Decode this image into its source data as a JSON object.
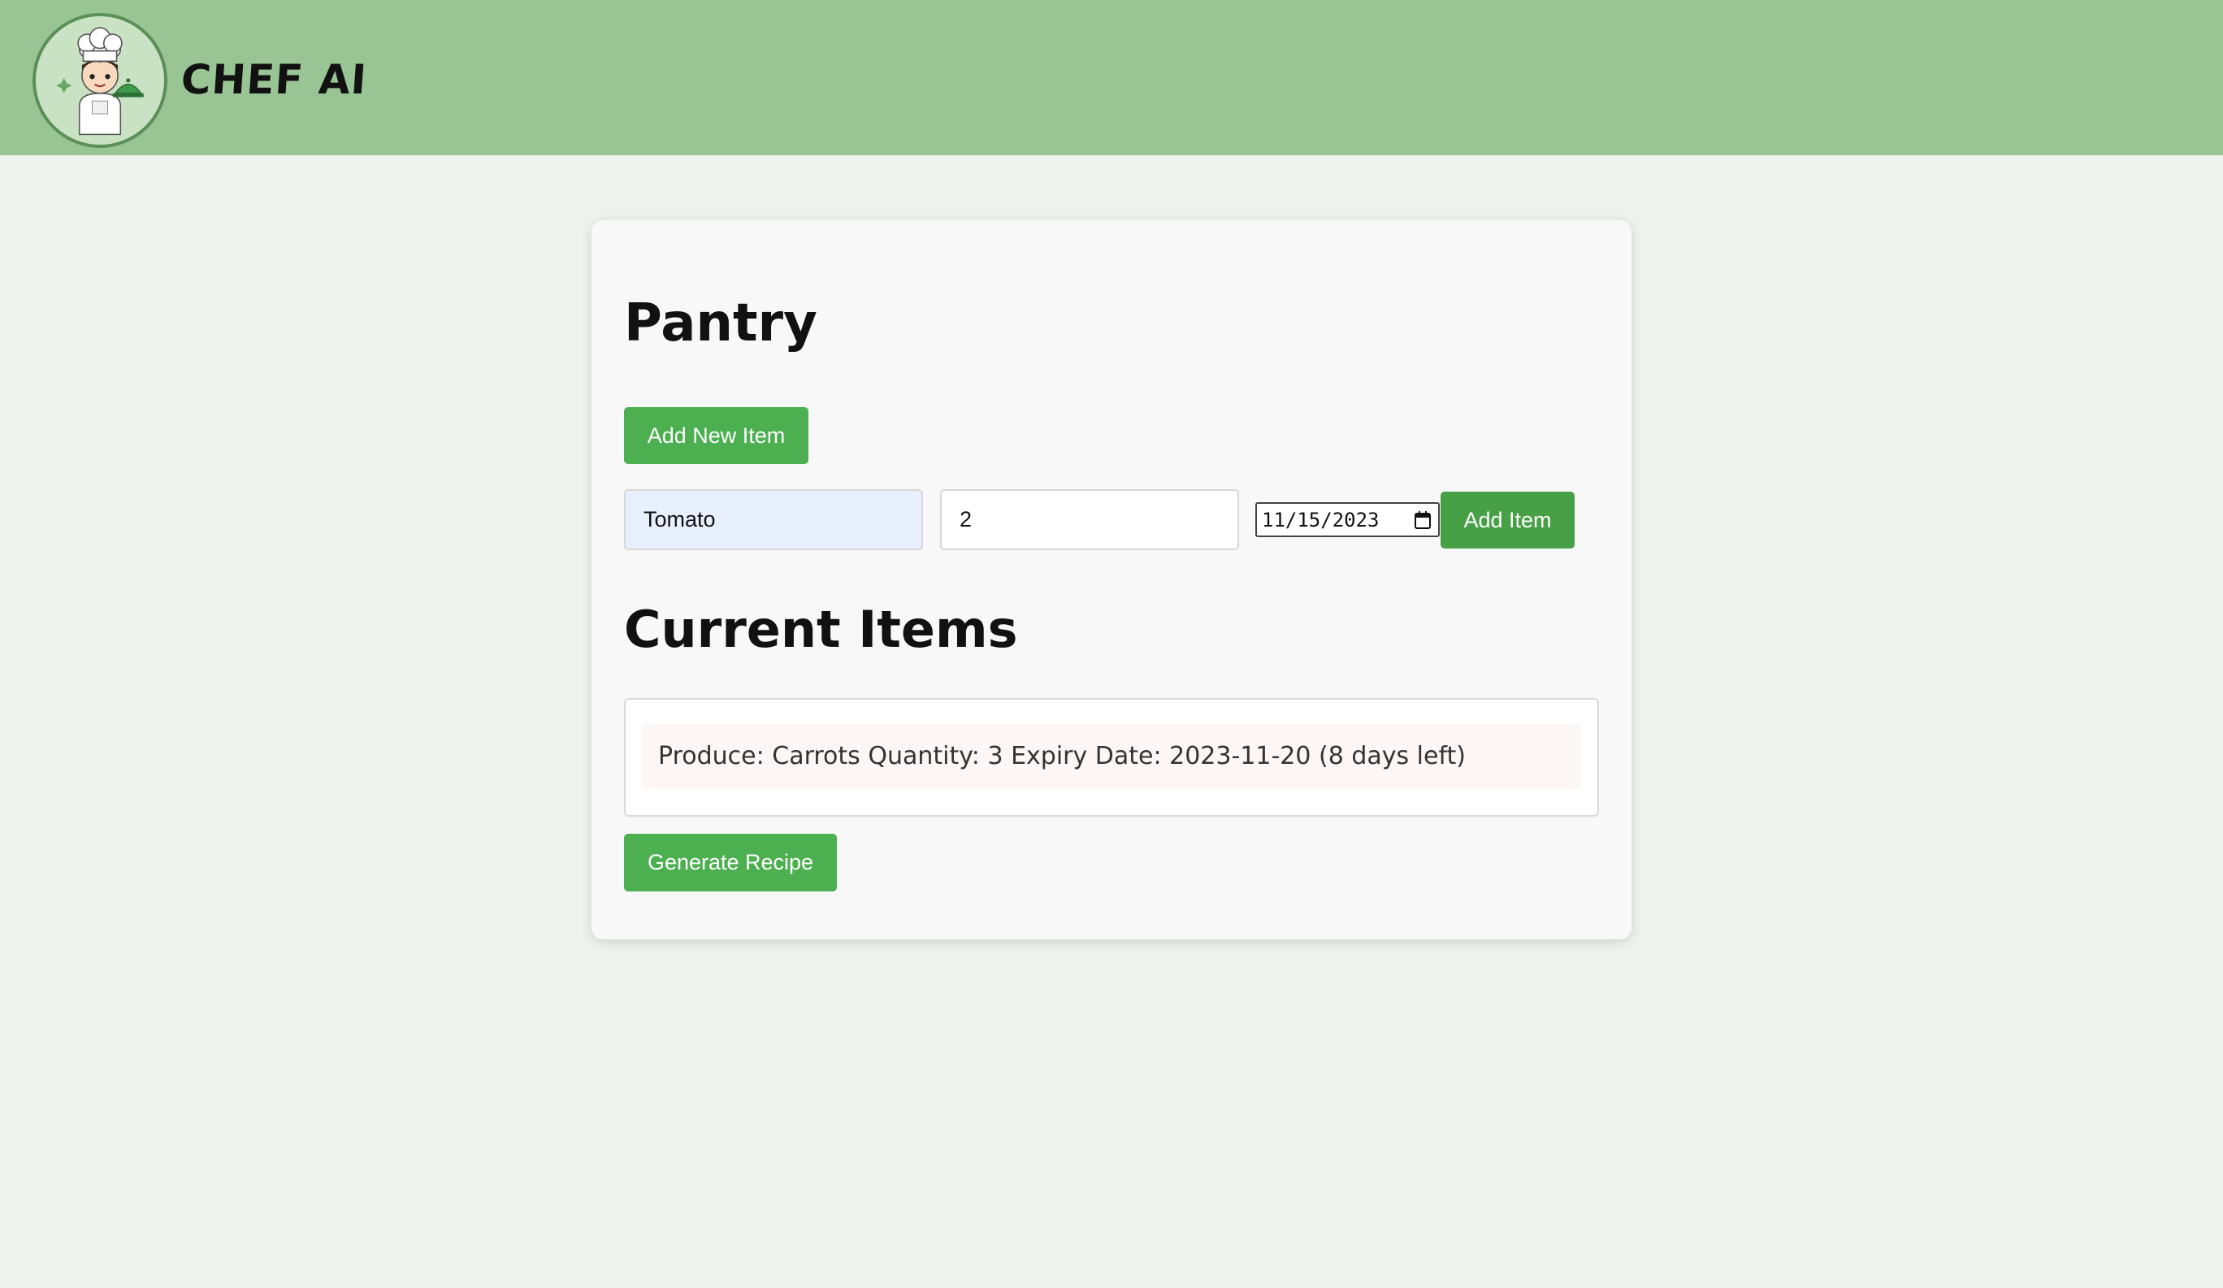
{
  "header": {
    "brand": "CHEF AI",
    "logo_icon": "chef-mascot-icon",
    "background_color": "#99c494"
  },
  "pantry": {
    "title": "Pantry",
    "add_new_button": "Add New Item",
    "form": {
      "name_value": "Tomato",
      "quantity_value": "2",
      "expiry_date_value": "11/15/2023",
      "calendar_icon": "calendar-icon",
      "add_button": "Add Item"
    },
    "current_items_title": "Current Items",
    "items": [
      {
        "text": "Produce: Carrots Quantity: 3 Expiry Date: 2023-11-20 (8 days left)"
      }
    ],
    "generate_button": "Generate Recipe",
    "accent_color": "#4caf50"
  }
}
